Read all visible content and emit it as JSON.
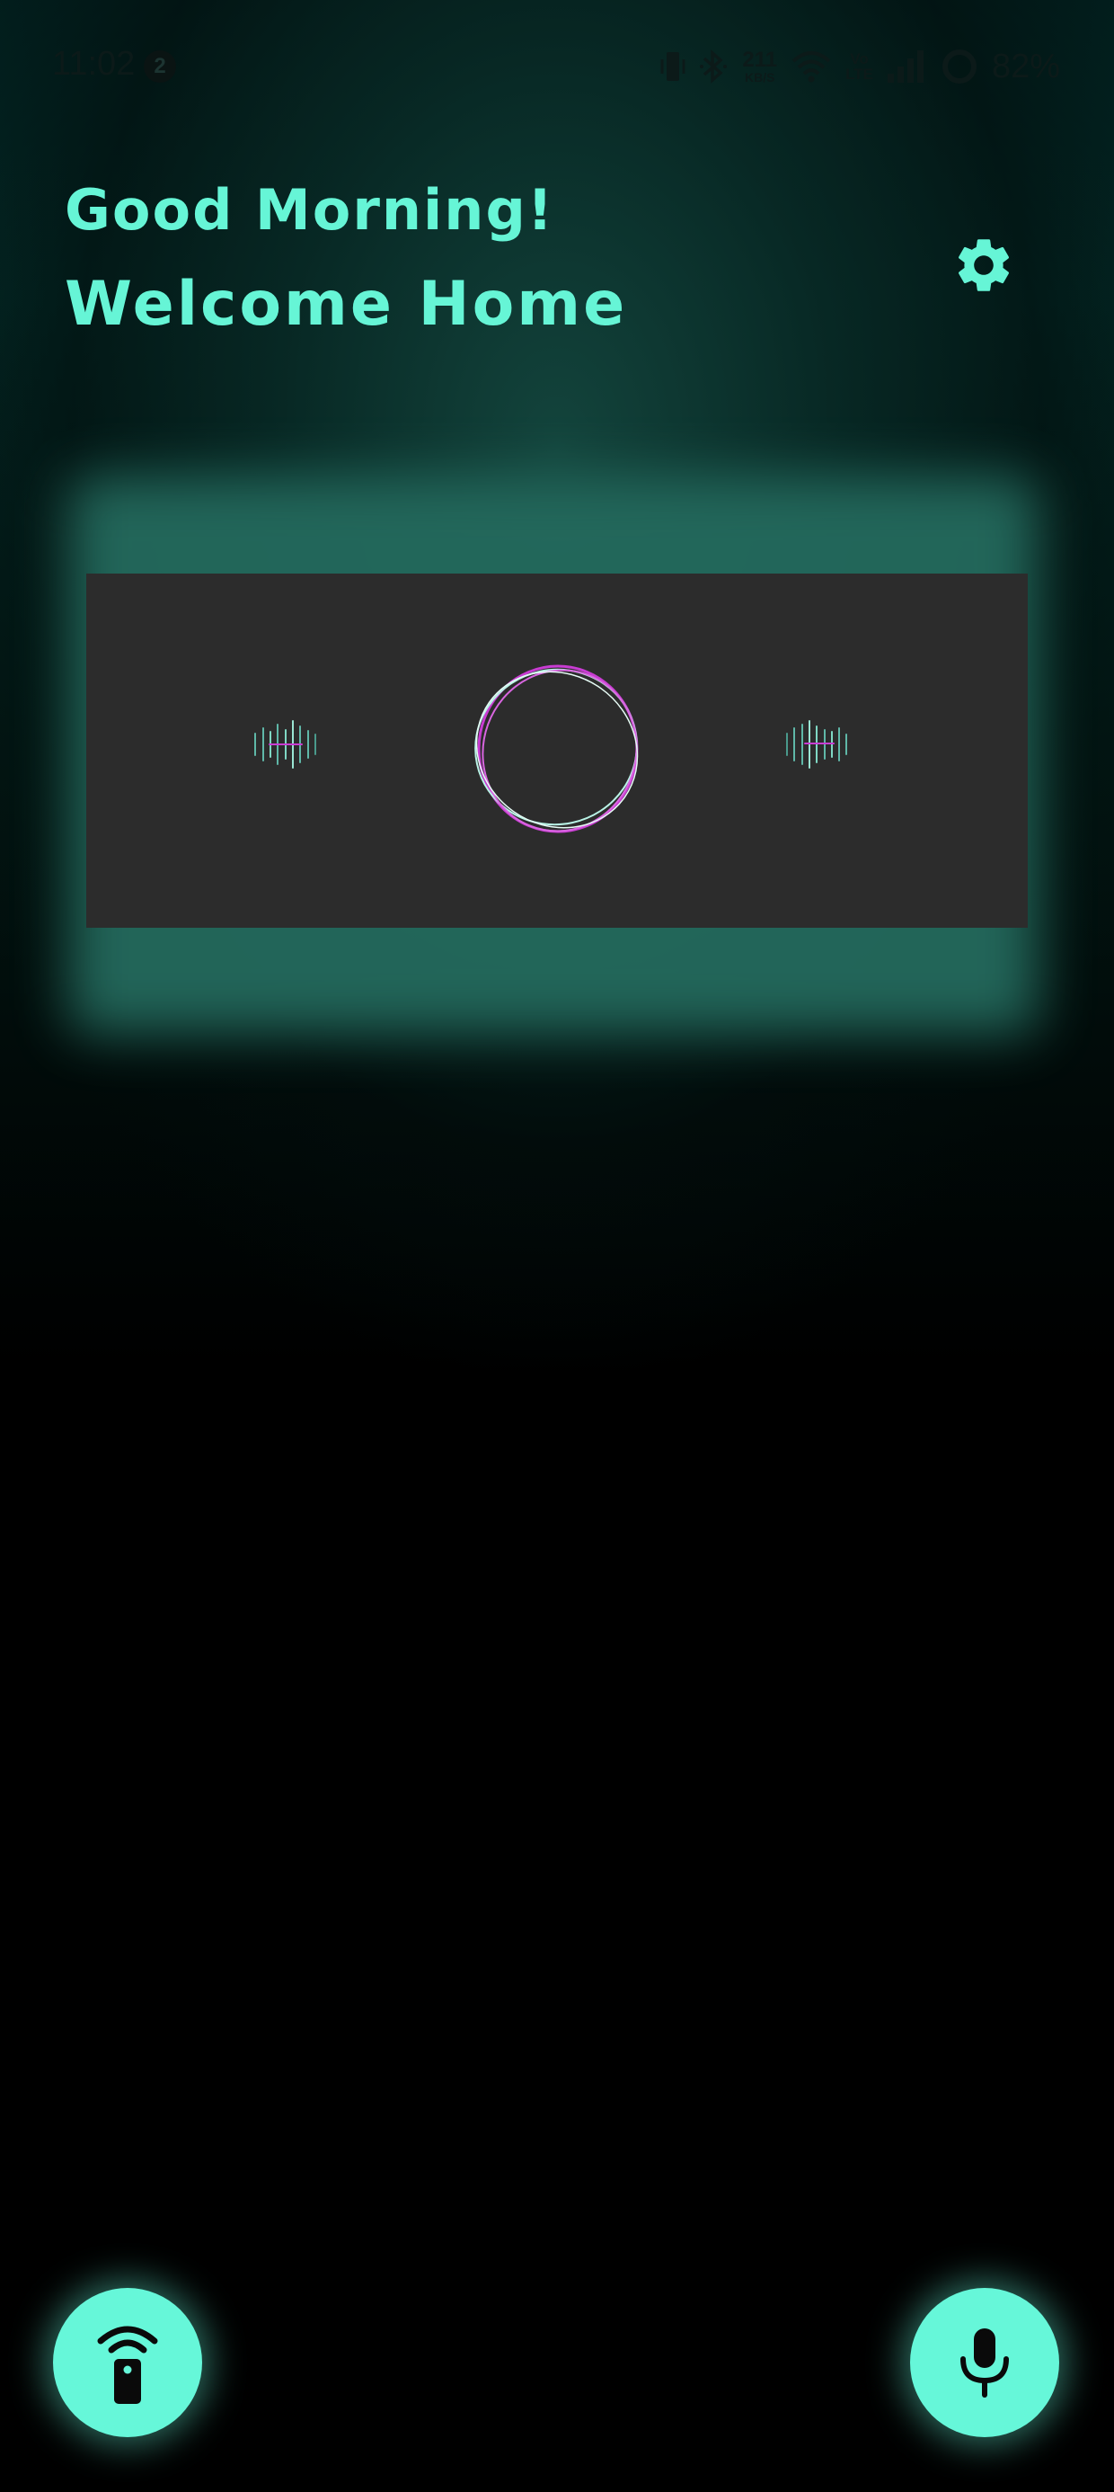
{
  "status_bar": {
    "time": "11:02",
    "notification_count": "2",
    "network_speed_value": "211",
    "network_speed_unit": "KB/S",
    "volte_top": "Vo",
    "volte_bottom": "LTE",
    "battery_percent": "82%",
    "icons": [
      "vibrate-icon",
      "bluetooth-icon",
      "wifi-icon",
      "signal-icon",
      "battery-ring-icon"
    ]
  },
  "header": {
    "greeting": "Good Morning!",
    "welcome": "Welcome Home",
    "settings_icon": "gear-icon"
  },
  "visualizer": {
    "center_icon": "ring-waveform-icon",
    "left_icon": "audio-bars-icon",
    "right_icon": "audio-bars-icon"
  },
  "bottom_actions": {
    "left_icon": "remote-wifi-icon",
    "right_icon": "microphone-icon"
  },
  "colors": {
    "accent": "#66f5d6",
    "card_background": "#2c2c2c",
    "glow": "#246a5d",
    "magenta": "#c83cd2"
  }
}
